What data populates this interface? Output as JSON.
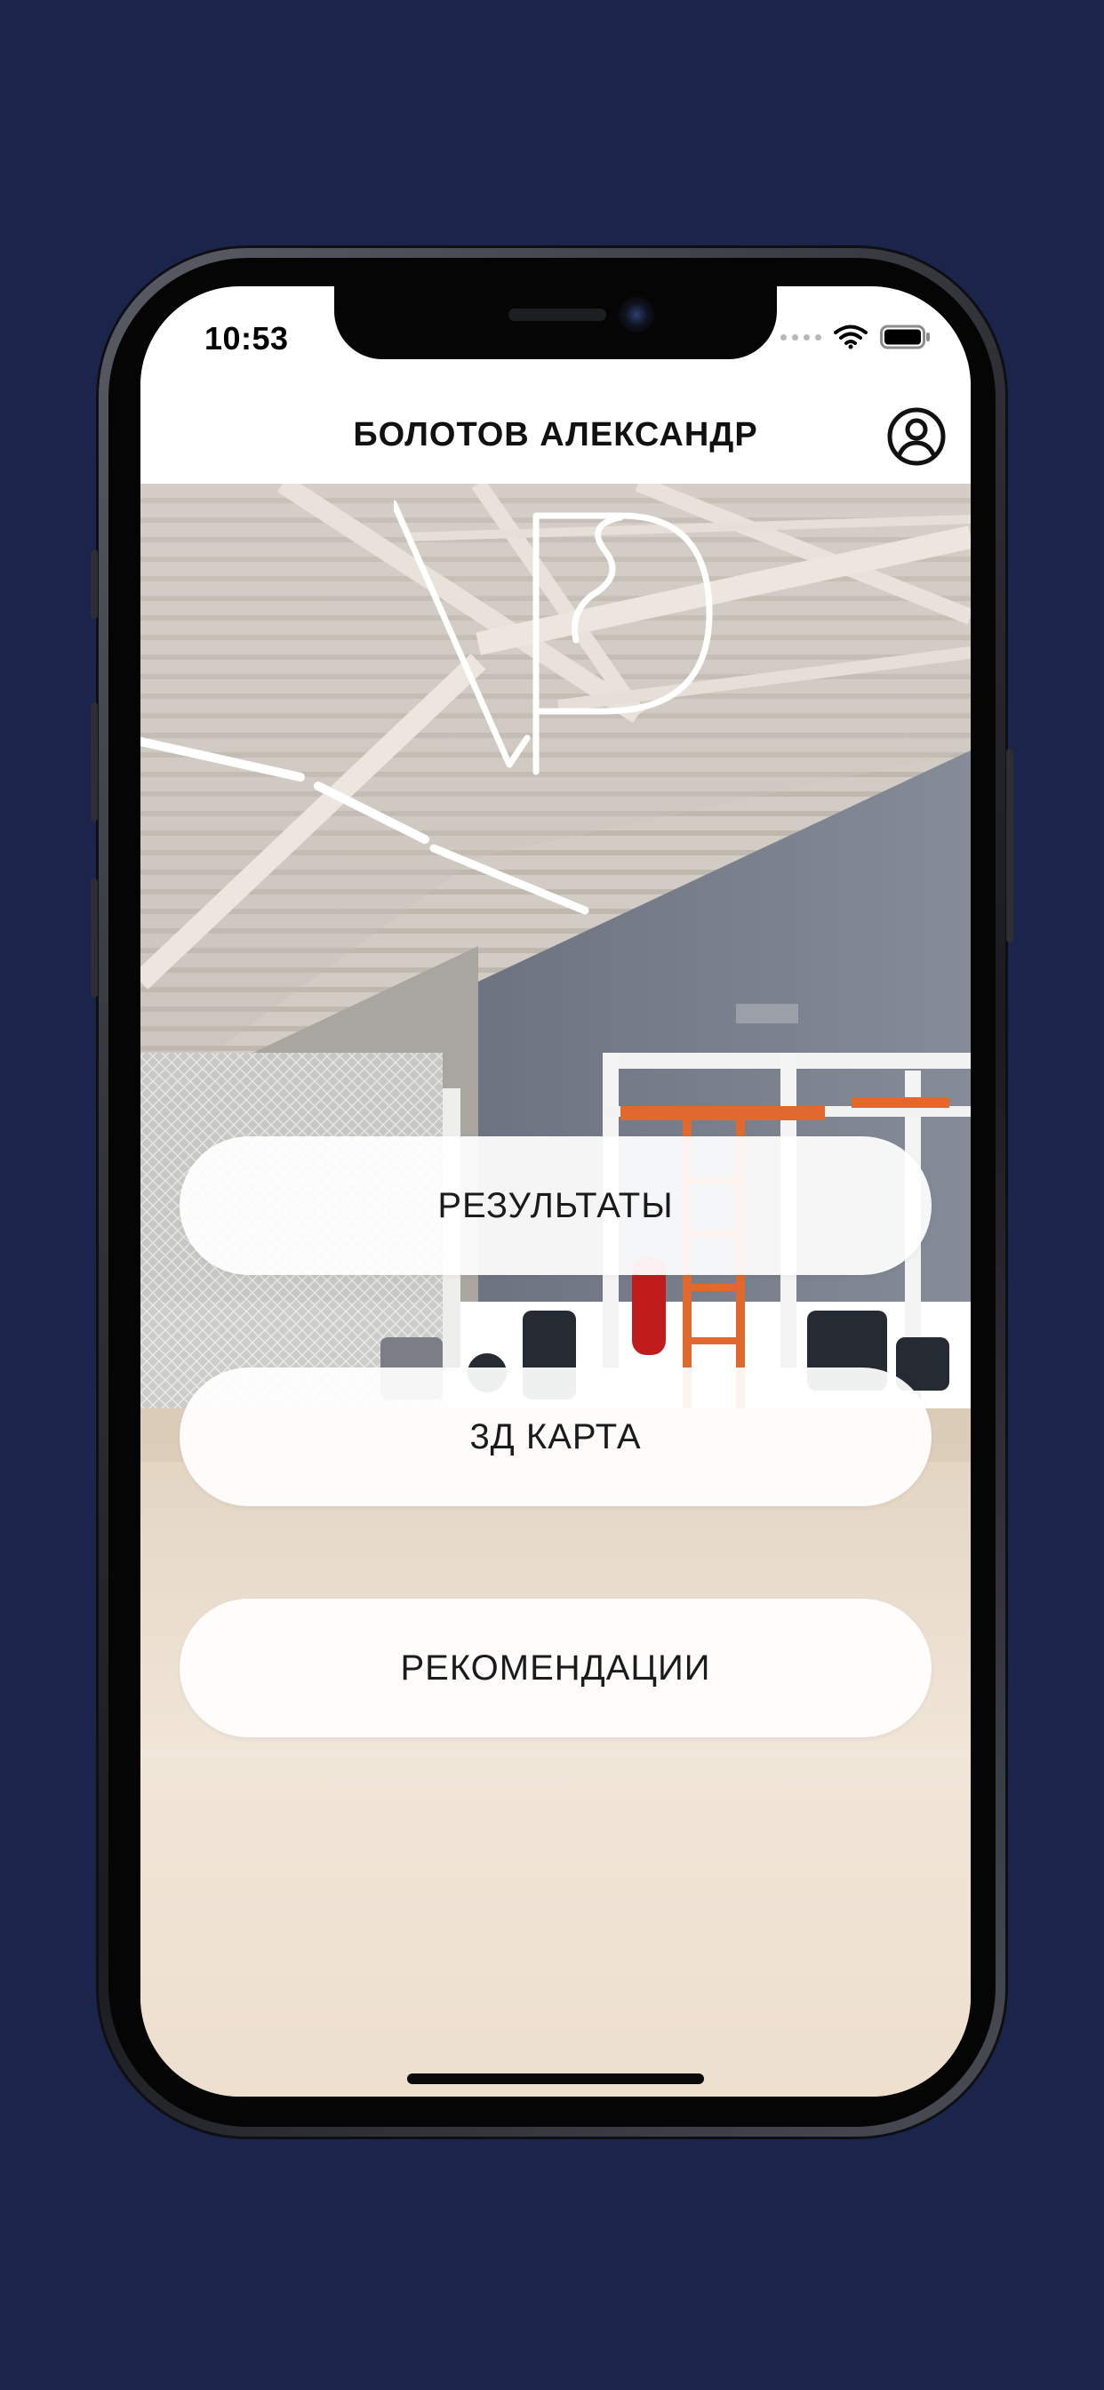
{
  "status_bar": {
    "time": "10:53"
  },
  "header": {
    "title": "БОЛОТОВ АЛЕКСАНДР",
    "profile_icon": "user-circle-icon"
  },
  "logo": {
    "text": "VP"
  },
  "menu": [
    {
      "label": "РЕЗУЛЬТАТЫ"
    },
    {
      "label": "3Д КАРТА"
    },
    {
      "label": "РЕКОМЕНДАЦИИ"
    }
  ],
  "colors": {
    "page_background": "#1b244b",
    "button_background": "#ffffff",
    "text": "#111111"
  }
}
